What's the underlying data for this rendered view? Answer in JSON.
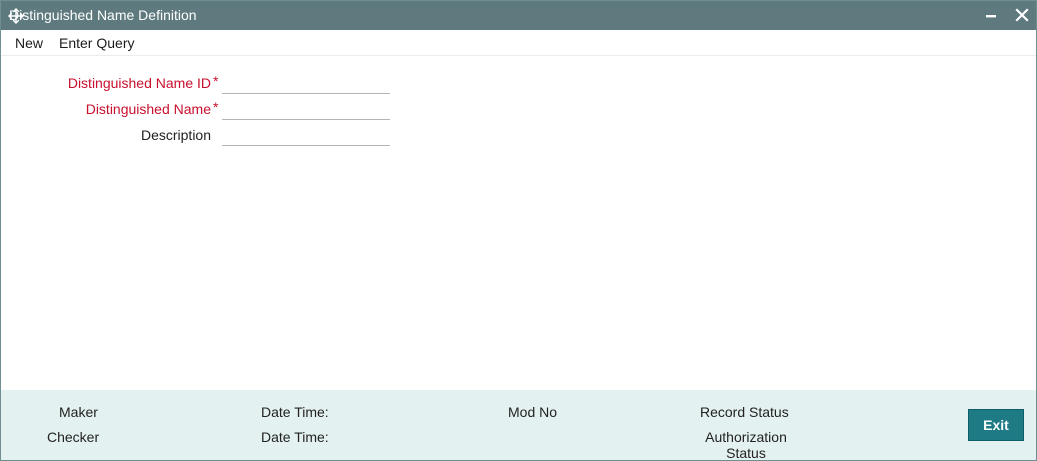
{
  "window": {
    "title": "Distinguished Name Definition",
    "title_bar_color": "#5e7a7e"
  },
  "icons": {
    "move": "move-arrows-icon",
    "minimize": "minimize-icon",
    "close": "close-icon"
  },
  "menu": {
    "new_label": "New",
    "enter_query_label": "Enter Query"
  },
  "form": {
    "fields": [
      {
        "label": "Distinguished Name ID",
        "required": true,
        "value": ""
      },
      {
        "label": "Distinguished Name",
        "required": true,
        "value": ""
      },
      {
        "label": "Description",
        "required": false,
        "value": ""
      }
    ],
    "required_marker": "*",
    "required_color": "#c8102e"
  },
  "footer": {
    "maker_label": "Maker",
    "checker_label": "Checker",
    "maker_datetime_label": "Date Time:",
    "checker_datetime_label": "Date Time:",
    "mod_no_label": "Mod No",
    "record_status_label": "Record Status",
    "authorization_status_label": "Authorization Status",
    "exit_label": "Exit",
    "background_color": "#e4f1f1",
    "exit_color": "#1e7a85"
  }
}
